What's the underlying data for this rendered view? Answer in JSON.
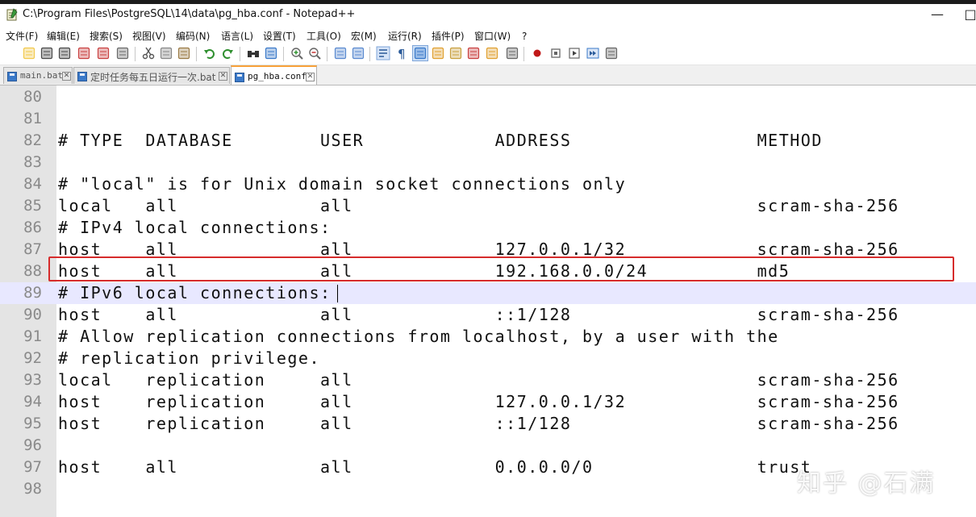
{
  "window": {
    "title": "C:\\Program Files\\PostgreSQL\\14\\data\\pg_hba.conf - Notepad++",
    "minimize": "—",
    "maximize": "□"
  },
  "menu": [
    "文件(F)",
    "编辑(E)",
    "搜索(S)",
    "视图(V)",
    "编码(N)",
    "语言(L)",
    "设置(T)",
    "工具(O)",
    "宏(M)",
    "运行(R)",
    "插件(P)",
    "窗口(W)",
    "?"
  ],
  "toolbar_icons": [
    "new-file-icon",
    "open-file-icon",
    "save-icon",
    "save-all-icon",
    "close-icon",
    "close-all-icon",
    "print-icon",
    "cut-icon",
    "copy-icon",
    "paste-icon",
    "undo-icon",
    "redo-icon",
    "find-icon",
    "replace-icon",
    "zoom-in-icon",
    "zoom-out-icon",
    "sync-vertical-icon",
    "sync-horizontal-icon",
    "word-wrap-icon",
    "show-all-chars-icon",
    "indent-guide-icon",
    "user-language-icon",
    "doc-map-icon",
    "function-list-icon",
    "folder-workspace-icon",
    "monitor-icon",
    "record-macro-icon",
    "stop-record-icon",
    "play-macro-icon",
    "run-macro-multiple-icon",
    "save-macro-icon"
  ],
  "tabs": [
    {
      "label": "main.bat",
      "active": false
    },
    {
      "label": "定时任务每五日运行一次.bat",
      "active": false
    },
    {
      "label": "pg_hba.conf",
      "active": true
    }
  ],
  "lines": [
    {
      "n": "80",
      "text": ""
    },
    {
      "n": "81",
      "text": ""
    },
    {
      "n": "82",
      "text": "# TYPE  DATABASE        USER            ADDRESS                 METHOD"
    },
    {
      "n": "83",
      "text": ""
    },
    {
      "n": "84",
      "text": "# \"local\" is for Unix domain socket connections only"
    },
    {
      "n": "85",
      "text": "local   all             all                                     scram-sha-256"
    },
    {
      "n": "86",
      "text": "# IPv4 local connections:"
    },
    {
      "n": "87",
      "text": "host    all             all             127.0.0.1/32            scram-sha-256"
    },
    {
      "n": "88",
      "text": "host    all             all             192.168.0.0/24          md5"
    },
    {
      "n": "89",
      "text": "# IPv6 local connections:"
    },
    {
      "n": "90",
      "text": "host    all             all             ::1/128                 scram-sha-256"
    },
    {
      "n": "91",
      "text": "# Allow replication connections from localhost, by a user with the"
    },
    {
      "n": "92",
      "text": "# replication privilege."
    },
    {
      "n": "93",
      "text": "local   replication     all                                     scram-sha-256"
    },
    {
      "n": "94",
      "text": "host    replication     all             127.0.0.1/32            scram-sha-256"
    },
    {
      "n": "95",
      "text": "host    replication     all             ::1/128                 scram-sha-256"
    },
    {
      "n": "96",
      "text": ""
    },
    {
      "n": "97",
      "text": "host    all             all             0.0.0.0/0               trust"
    },
    {
      "n": "98",
      "text": ""
    }
  ],
  "current_line": "89",
  "highlighted_line": "88",
  "watermark": "知乎 @石满",
  "colors": {
    "highlight_border": "#d62c2c",
    "current_line_bg": "#e8e8ff",
    "active_tab_accent": "#f7a13a"
  }
}
